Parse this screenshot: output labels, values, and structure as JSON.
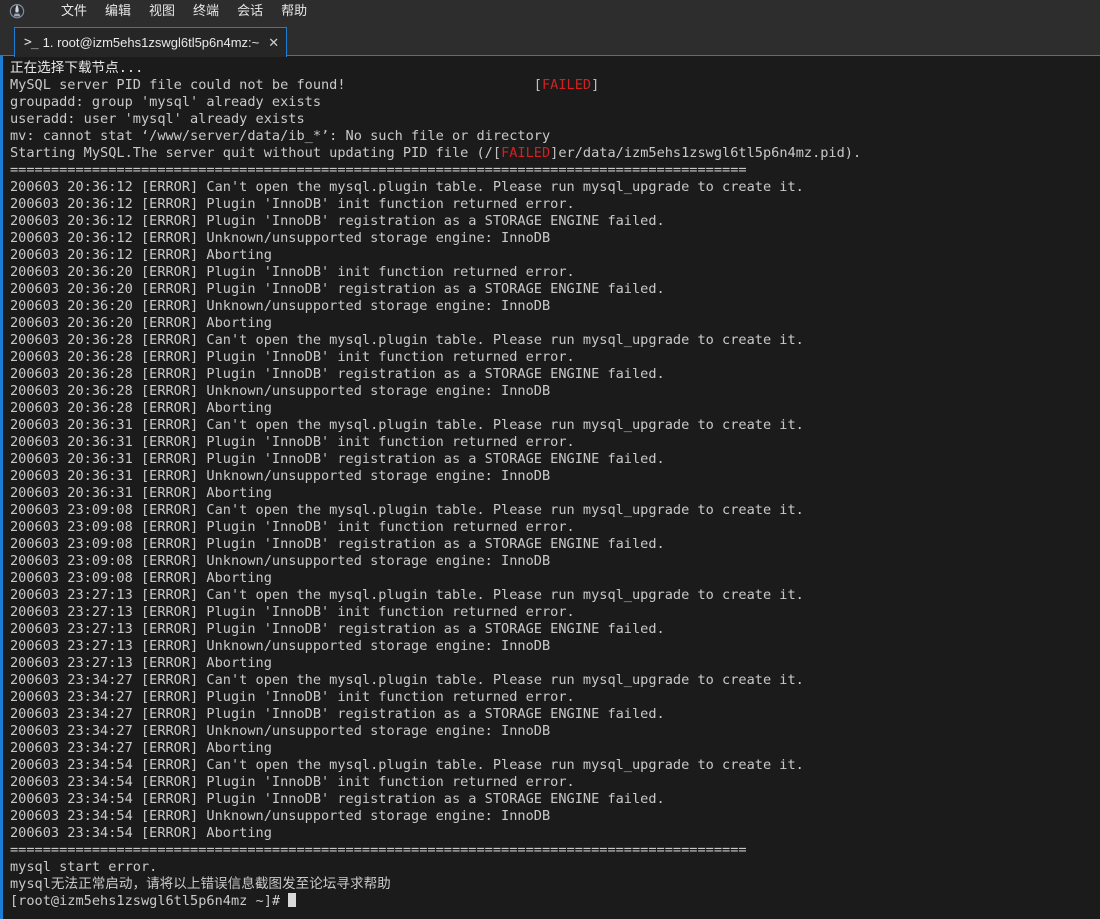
{
  "window": {
    "app_icon": "xshell-logo-icon"
  },
  "menubar": {
    "items": [
      {
        "label": "文件",
        "name": "menu-file"
      },
      {
        "label": "编辑",
        "name": "menu-edit"
      },
      {
        "label": "视图",
        "name": "menu-view"
      },
      {
        "label": "终端",
        "name": "menu-terminal"
      },
      {
        "label": "会话",
        "name": "menu-session"
      },
      {
        "label": "帮助",
        "name": "menu-help"
      }
    ]
  },
  "tabbar": {
    "active_tab": {
      "prompt_glyph": ">_",
      "label": "1. root@izm5ehs1zswgl6tl5p6n4mz:~",
      "close_label": "✕"
    }
  },
  "terminal": {
    "colors": {
      "background": "#1b1b1b",
      "foreground": "#d6d6d6",
      "error_red": "#d32020",
      "accent_blue": "#1a7fd4"
    },
    "separator": "==========================================================================================",
    "lines": [
      {
        "segments": [
          {
            "text": "正在选择下载节点...",
            "color": "white"
          }
        ]
      },
      {
        "segments": [
          {
            "text": "MySQL server PID file could not be found!                       ",
            "color": "gray"
          },
          {
            "text": "[",
            "color": "br"
          },
          {
            "text": "FAILED",
            "color": "red"
          },
          {
            "text": "]",
            "color": "br"
          }
        ]
      },
      {
        "segments": [
          {
            "text": "groupadd: group 'mysql' already exists",
            "color": "gray"
          }
        ]
      },
      {
        "segments": [
          {
            "text": "useradd: user 'mysql' already exists",
            "color": "gray"
          }
        ]
      },
      {
        "segments": [
          {
            "text": "mv: cannot stat ‘/www/server/data/ib_*’: No such file or directory",
            "color": "gray"
          }
        ]
      },
      {
        "segments": [
          {
            "text": "Starting MySQL.The server quit without updating PID file (/",
            "color": "gray"
          },
          {
            "text": "[",
            "color": "br"
          },
          {
            "text": "FAILED",
            "color": "red"
          },
          {
            "text": "]",
            "color": "br"
          },
          {
            "text": "er/data/izm5ehs1zswgl6tl5p6n4mz.pid).",
            "color": "gray"
          }
        ]
      },
      {
        "separator": true
      },
      {
        "segments": [
          {
            "text": "200603 20:36:12 [ERROR] Can't open the mysql.plugin table. Please run mysql_upgrade to create it.",
            "color": "gray"
          }
        ]
      },
      {
        "segments": [
          {
            "text": "200603 20:36:12 [ERROR] Plugin 'InnoDB' init function returned error.",
            "color": "gray"
          }
        ]
      },
      {
        "segments": [
          {
            "text": "200603 20:36:12 [ERROR] Plugin 'InnoDB' registration as a STORAGE ENGINE failed.",
            "color": "gray"
          }
        ]
      },
      {
        "segments": [
          {
            "text": "200603 20:36:12 [ERROR] Unknown/unsupported storage engine: InnoDB",
            "color": "gray"
          }
        ]
      },
      {
        "segments": [
          {
            "text": "200603 20:36:12 [ERROR] Aborting",
            "color": "gray"
          }
        ]
      },
      {
        "segments": [
          {
            "text": "200603 20:36:20 [ERROR] Plugin 'InnoDB' init function returned error.",
            "color": "gray"
          }
        ]
      },
      {
        "segments": [
          {
            "text": "200603 20:36:20 [ERROR] Plugin 'InnoDB' registration as a STORAGE ENGINE failed.",
            "color": "gray"
          }
        ]
      },
      {
        "segments": [
          {
            "text": "200603 20:36:20 [ERROR] Unknown/unsupported storage engine: InnoDB",
            "color": "gray"
          }
        ]
      },
      {
        "segments": [
          {
            "text": "200603 20:36:20 [ERROR] Aborting",
            "color": "gray"
          }
        ]
      },
      {
        "segments": [
          {
            "text": "200603 20:36:28 [ERROR] Can't open the mysql.plugin table. Please run mysql_upgrade to create it.",
            "color": "gray"
          }
        ]
      },
      {
        "segments": [
          {
            "text": "200603 20:36:28 [ERROR] Plugin 'InnoDB' init function returned error.",
            "color": "gray"
          }
        ]
      },
      {
        "segments": [
          {
            "text": "200603 20:36:28 [ERROR] Plugin 'InnoDB' registration as a STORAGE ENGINE failed.",
            "color": "gray"
          }
        ]
      },
      {
        "segments": [
          {
            "text": "200603 20:36:28 [ERROR] Unknown/unsupported storage engine: InnoDB",
            "color": "gray"
          }
        ]
      },
      {
        "segments": [
          {
            "text": "200603 20:36:28 [ERROR] Aborting",
            "color": "gray"
          }
        ]
      },
      {
        "segments": [
          {
            "text": "200603 20:36:31 [ERROR] Can't open the mysql.plugin table. Please run mysql_upgrade to create it.",
            "color": "gray"
          }
        ]
      },
      {
        "segments": [
          {
            "text": "200603 20:36:31 [ERROR] Plugin 'InnoDB' init function returned error.",
            "color": "gray"
          }
        ]
      },
      {
        "segments": [
          {
            "text": "200603 20:36:31 [ERROR] Plugin 'InnoDB' registration as a STORAGE ENGINE failed.",
            "color": "gray"
          }
        ]
      },
      {
        "segments": [
          {
            "text": "200603 20:36:31 [ERROR] Unknown/unsupported storage engine: InnoDB",
            "color": "gray"
          }
        ]
      },
      {
        "segments": [
          {
            "text": "200603 20:36:31 [ERROR] Aborting",
            "color": "gray"
          }
        ]
      },
      {
        "segments": [
          {
            "text": "200603 23:09:08 [ERROR] Can't open the mysql.plugin table. Please run mysql_upgrade to create it.",
            "color": "gray"
          }
        ]
      },
      {
        "segments": [
          {
            "text": "200603 23:09:08 [ERROR] Plugin 'InnoDB' init function returned error.",
            "color": "gray"
          }
        ]
      },
      {
        "segments": [
          {
            "text": "200603 23:09:08 [ERROR] Plugin 'InnoDB' registration as a STORAGE ENGINE failed.",
            "color": "gray"
          }
        ]
      },
      {
        "segments": [
          {
            "text": "200603 23:09:08 [ERROR] Unknown/unsupported storage engine: InnoDB",
            "color": "gray"
          }
        ]
      },
      {
        "segments": [
          {
            "text": "200603 23:09:08 [ERROR] Aborting",
            "color": "gray"
          }
        ]
      },
      {
        "segments": [
          {
            "text": "200603 23:27:13 [ERROR] Can't open the mysql.plugin table. Please run mysql_upgrade to create it.",
            "color": "gray"
          }
        ]
      },
      {
        "segments": [
          {
            "text": "200603 23:27:13 [ERROR] Plugin 'InnoDB' init function returned error.",
            "color": "gray"
          }
        ]
      },
      {
        "segments": [
          {
            "text": "200603 23:27:13 [ERROR] Plugin 'InnoDB' registration as a STORAGE ENGINE failed.",
            "color": "gray"
          }
        ]
      },
      {
        "segments": [
          {
            "text": "200603 23:27:13 [ERROR] Unknown/unsupported storage engine: InnoDB",
            "color": "gray"
          }
        ]
      },
      {
        "segments": [
          {
            "text": "200603 23:27:13 [ERROR] Aborting",
            "color": "gray"
          }
        ]
      },
      {
        "segments": [
          {
            "text": "200603 23:34:27 [ERROR] Can't open the mysql.plugin table. Please run mysql_upgrade to create it.",
            "color": "gray"
          }
        ]
      },
      {
        "segments": [
          {
            "text": "200603 23:34:27 [ERROR] Plugin 'InnoDB' init function returned error.",
            "color": "gray"
          }
        ]
      },
      {
        "segments": [
          {
            "text": "200603 23:34:27 [ERROR] Plugin 'InnoDB' registration as a STORAGE ENGINE failed.",
            "color": "gray"
          }
        ]
      },
      {
        "segments": [
          {
            "text": "200603 23:34:27 [ERROR] Unknown/unsupported storage engine: InnoDB",
            "color": "gray"
          }
        ]
      },
      {
        "segments": [
          {
            "text": "200603 23:34:27 [ERROR] Aborting",
            "color": "gray"
          }
        ]
      },
      {
        "segments": [
          {
            "text": "200603 23:34:54 [ERROR] Can't open the mysql.plugin table. Please run mysql_upgrade to create it.",
            "color": "gray"
          }
        ]
      },
      {
        "segments": [
          {
            "text": "200603 23:34:54 [ERROR] Plugin 'InnoDB' init function returned error.",
            "color": "gray"
          }
        ]
      },
      {
        "segments": [
          {
            "text": "200603 23:34:54 [ERROR] Plugin 'InnoDB' registration as a STORAGE ENGINE failed.",
            "color": "gray"
          }
        ]
      },
      {
        "segments": [
          {
            "text": "200603 23:34:54 [ERROR] Unknown/unsupported storage engine: InnoDB",
            "color": "gray"
          }
        ]
      },
      {
        "segments": [
          {
            "text": "200603 23:34:54 [ERROR] Aborting",
            "color": "gray"
          }
        ]
      },
      {
        "separator": true
      },
      {
        "segments": [
          {
            "text": "mysql start error.",
            "color": "gray"
          }
        ]
      },
      {
        "segments": [
          {
            "text": "mysql无法正常启动，请将以上错误信息截图发至论坛寻求帮助",
            "color": "gray"
          }
        ]
      },
      {
        "segments": [
          {
            "text": "[root@izm5ehs1zswgl6tl5p6n4mz ~]# ",
            "color": "gray"
          }
        ],
        "cursor": true
      }
    ]
  }
}
